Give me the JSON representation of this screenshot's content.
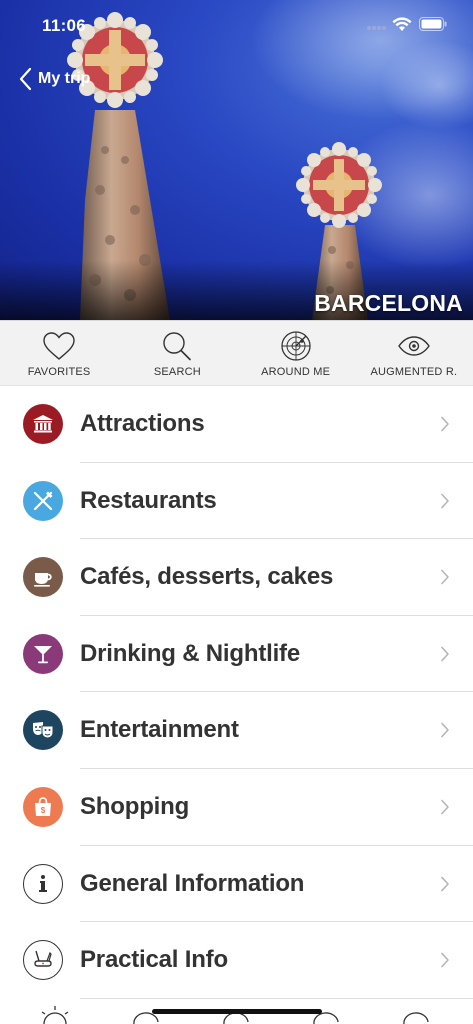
{
  "status_bar": {
    "time": "11:06"
  },
  "header": {
    "back_label": "My trip",
    "city": "BARCELONA"
  },
  "toolbar": [
    {
      "label": "FAVORITES",
      "icon": "heart-icon"
    },
    {
      "label": "SEARCH",
      "icon": "search-icon"
    },
    {
      "label": "AROUND ME",
      "icon": "radar-icon"
    },
    {
      "label": "AUGMENTED R.",
      "icon": "eye-icon"
    }
  ],
  "categories": [
    {
      "label": "Attractions",
      "icon": "museum-icon",
      "color": "#9b1b24"
    },
    {
      "label": "Restaurants",
      "icon": "fork-knife-icon",
      "color": "#4aa8e0"
    },
    {
      "label": "Cafés, desserts, cakes",
      "icon": "coffee-cup-icon",
      "color": "#7a5a48"
    },
    {
      "label": "Drinking & Nightlife",
      "icon": "cocktail-icon",
      "color": "#8a3a78"
    },
    {
      "label": "Entertainment",
      "icon": "theater-masks-icon",
      "color": "#1e4560"
    },
    {
      "label": "Shopping",
      "icon": "shopping-bag-icon",
      "color": "#ee7a52"
    },
    {
      "label": "General Information",
      "icon": "info-icon",
      "color": "#ffffff"
    },
    {
      "label": "Practical Info",
      "icon": "swiss-knife-icon",
      "color": "#ffffff"
    }
  ],
  "colors": {
    "toolbar_bg": "#f2f2f2",
    "separator": "#dedede",
    "text": "#333333",
    "sky": "#2a49c4"
  }
}
